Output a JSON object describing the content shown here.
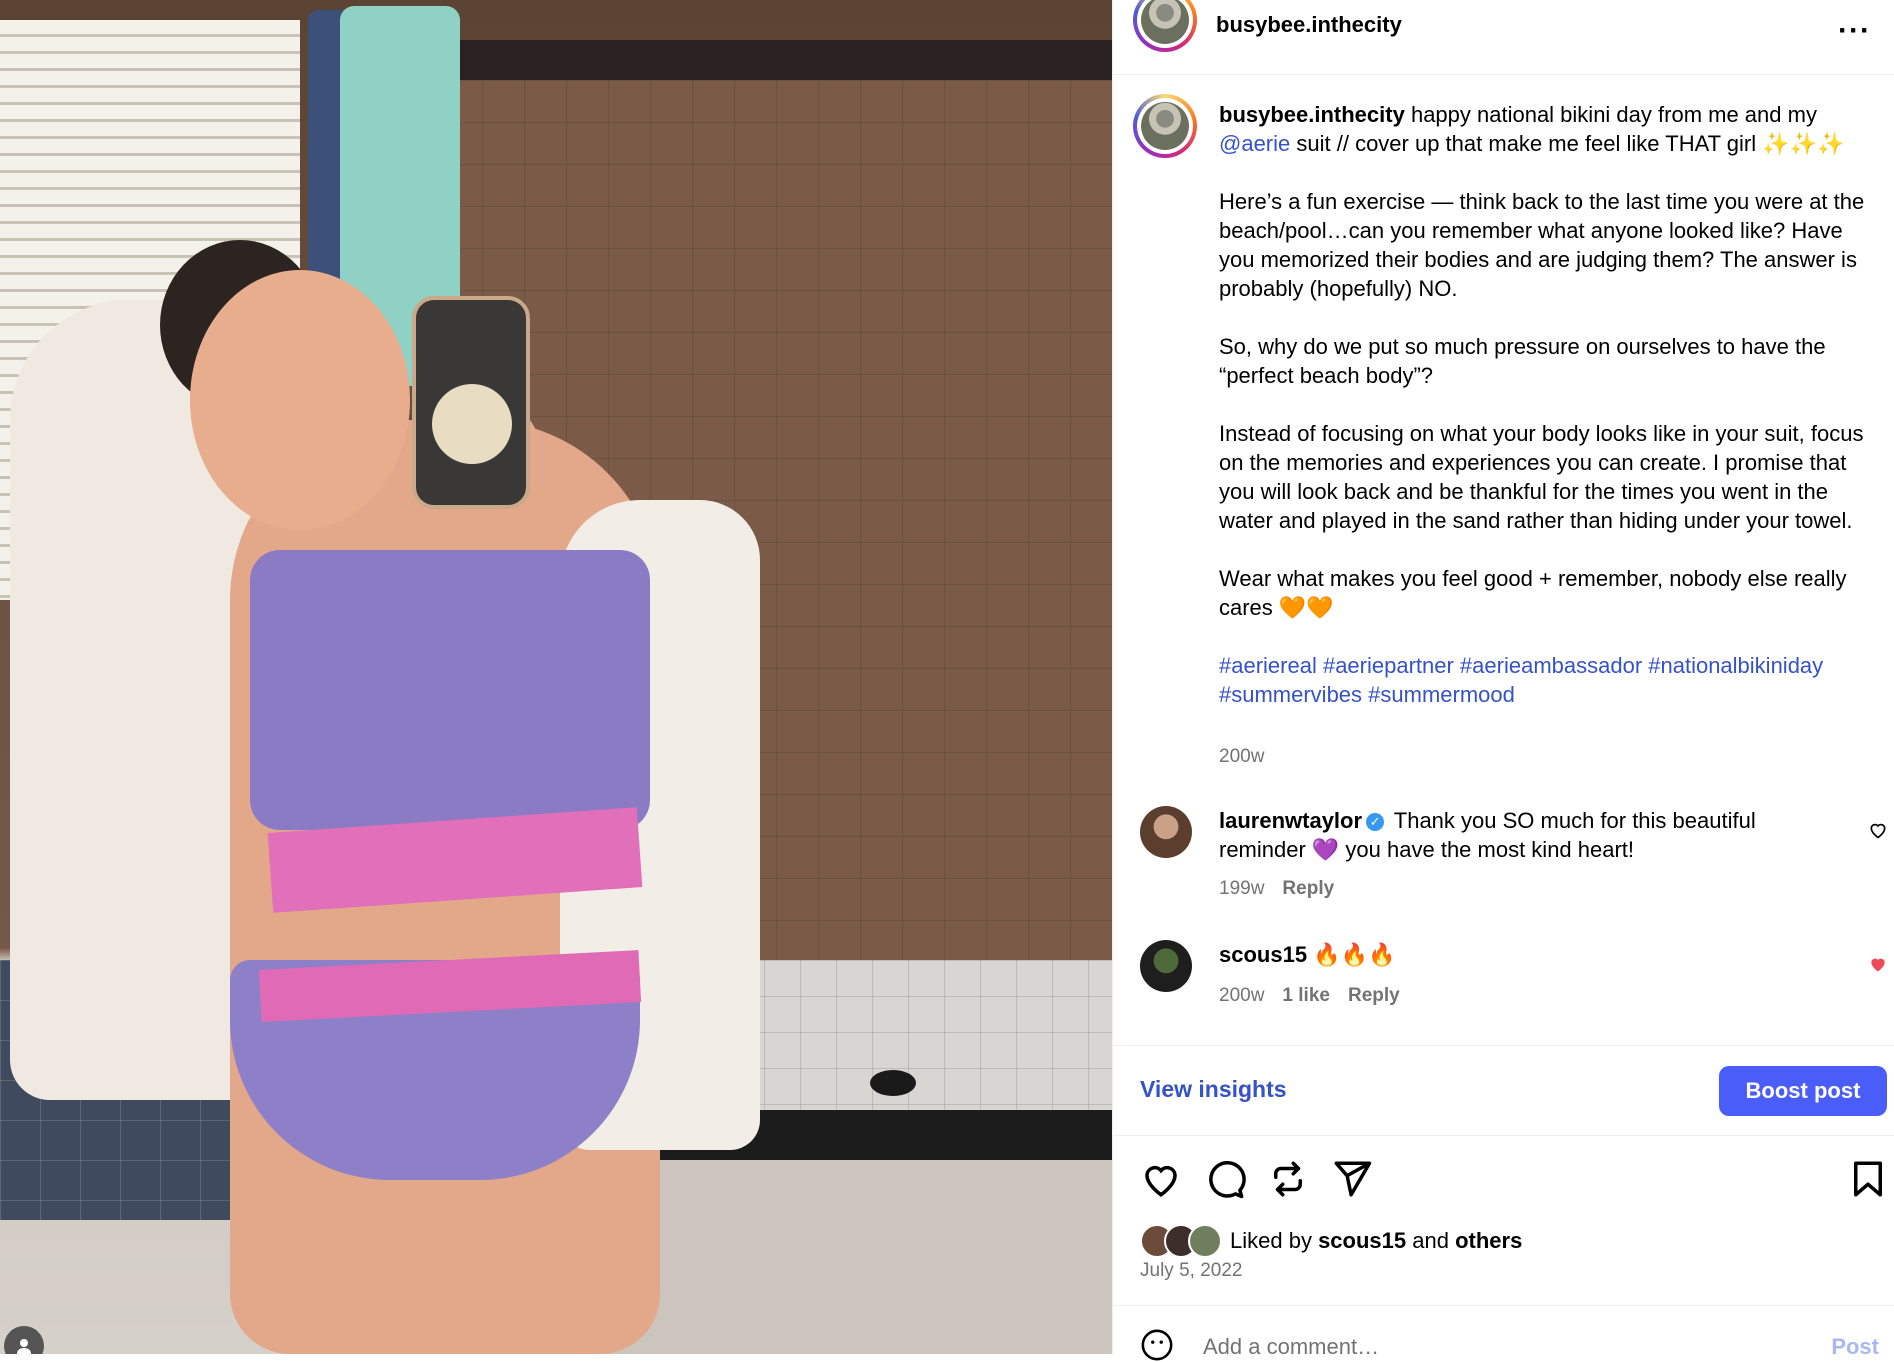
{
  "post": {
    "username": "busybee.inthecity",
    "caption": {
      "username": "busybee.inthecity",
      "line1": " happy national bikini day from me and my",
      "mention": "@aerie",
      "line2": " suit // cover up that make me feel like THAT girl ✨✨✨",
      "para2": "Here’s a fun exercise — think back to the last time you were at the beach/pool…can you remember what anyone looked like? Have you memorized their bodies and are judging them? The answer is probably (hopefully) NO.",
      "para3": "So, why do we put so much pressure on ourselves to have the “perfect beach body”?",
      "para4": "Instead of focusing on what your body looks like in your suit, focus on the memories and experiences you can create. I promise that you will look back and be thankful for the times you went in the water and played in the sand rather than hiding under your towel.",
      "para5": "Wear what makes you feel good + remember, nobody else really cares 🧡🧡",
      "hashtags": "#aeriereal #aeriepartner #aerieambassador #nationalbikiniday #summervibes #summermood",
      "time": "200w"
    },
    "comments": [
      {
        "user": "laurenwtaylor",
        "verified": "✓",
        "text": "Thank you SO much for this beautiful reminder 💜 you have the most kind heart!",
        "time": "199w",
        "reply": "Reply"
      },
      {
        "user": "scous15",
        "text": "🔥🔥🔥",
        "time": "200w",
        "likes": "1 like",
        "reply": "Reply"
      }
    ],
    "insights_label": "View insights",
    "boost_label": "Boost post",
    "liked_by": {
      "prefix": "Liked by ",
      "user": "scous15",
      "mid": " and ",
      "others": "others"
    },
    "date": "July 5, 2022",
    "comment_placeholder": "Add a comment…",
    "post_label": "Post"
  },
  "colors": {
    "link": "#3552c8",
    "boost": "#4a5df9",
    "liked_heart": "#ed4956"
  },
  "icons": [
    "heart-icon",
    "comment-icon",
    "repost-icon",
    "share-icon",
    "bookmark-icon",
    "more-icon",
    "emoji-icon",
    "user-icon"
  ]
}
